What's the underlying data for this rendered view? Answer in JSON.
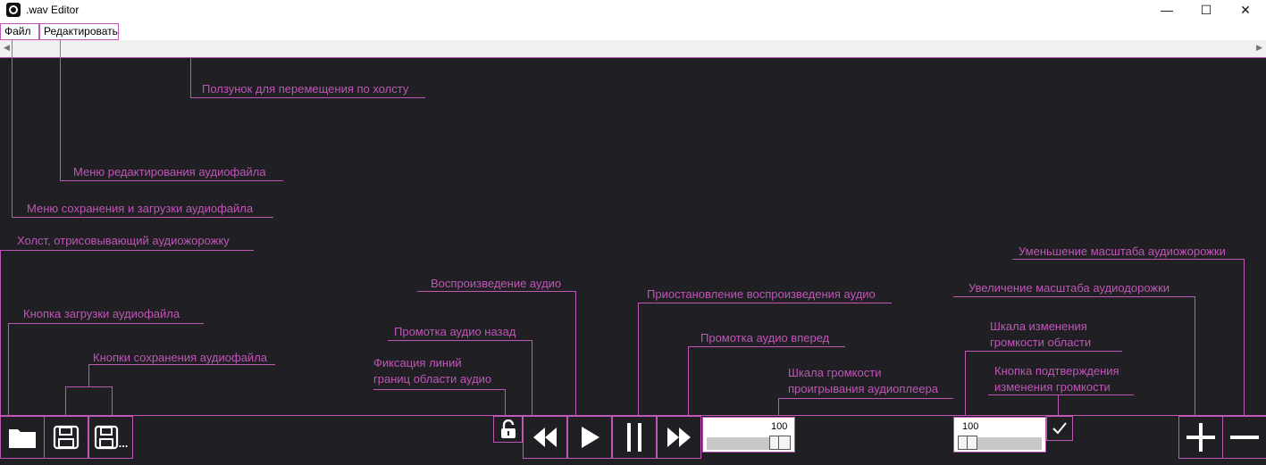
{
  "window": {
    "title": ".wav Editor",
    "minimize_glyph": "—",
    "maximize_glyph": "☐",
    "close_glyph": "✕"
  },
  "menu": {
    "file": "Файл",
    "edit": "Редактировать"
  },
  "annotations": {
    "scroll_slider": "Ползунок для перемещения по холсту",
    "edit_menu": "Меню редактирования аудиофайла",
    "file_menu": "Меню сохранения и загрузки аудиофайла",
    "canvas": "Холст, отрисовывающий аудиожорожку",
    "load_button": "Кнопка загрузки аудиофайла",
    "save_buttons": "Кнопки сохранения аудиофайла",
    "lock_line1": "Фиксация линий",
    "lock_line2": "границ области аудио",
    "rewind": "Промотка аудио назад",
    "play": "Воспроизведение аудио",
    "pause": "Приостановление воспроизведения аудио",
    "forward": "Промотка аудио вперед",
    "player_volume_line1": "Шкала громкости",
    "player_volume_line2": "проигрывания аудиоплеера",
    "region_volume_line1": "Шкала изменения",
    "region_volume_line2": "громкости области",
    "confirm_line1": "Кнопка подтверждения",
    "confirm_line2": "изменения громкости",
    "zoom_in": "Увеличение масштаба аудиодорожки",
    "zoom_out": "Уменьшение масштаба аудиожорожки"
  },
  "controls": {
    "player_volume_value": "100",
    "player_volume_level": 0.85,
    "region_volume_value": "100",
    "region_volume_level": 0.12,
    "save_as_suffix": "..."
  },
  "icons": [
    "folder-icon",
    "save-icon",
    "save-as-icon",
    "lock-open-icon",
    "rewind-icon",
    "play-icon",
    "pause-icon",
    "fast-forward-icon",
    "check-icon",
    "plus-icon",
    "minus-icon"
  ],
  "colors": {
    "annotation": "#c056b6",
    "background": "#1f1f24"
  }
}
